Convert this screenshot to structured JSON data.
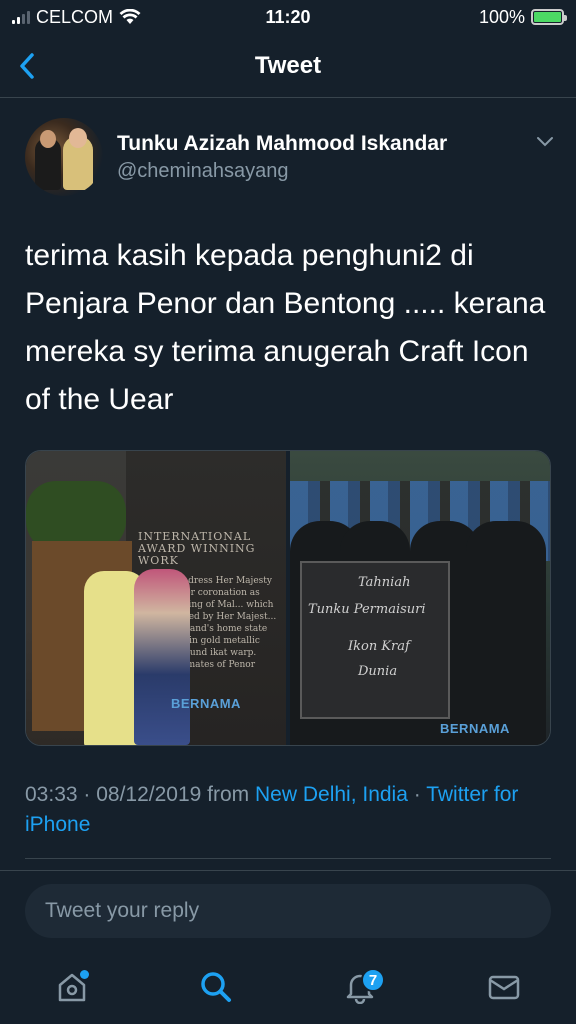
{
  "status_bar": {
    "carrier": "CELCOM",
    "time": "11:20",
    "battery": "100%"
  },
  "header": {
    "title": "Tweet"
  },
  "tweet": {
    "author_name": "Tunku Azizah Mahmood Iskandar",
    "author_handle": "@cheminahsayang",
    "text": "terima kasih kepada penghuni2 di Penjara Penor dan Bentong ..... kerana mereka sy terima anugerah Craft Icon of the Uear",
    "timestamp": "03:33 · 08/12/2019 from ",
    "location": "New Delhi, India",
    "separator": " · ",
    "source": "Twitter for iPhone"
  },
  "media": {
    "image1": {
      "plaque": "INTERNATIONAL AWARD WINNING WORK",
      "caption": "This is the dress Her Majesty wore for her coronation as The 16th King of Mal... which was designed by Her Majest... of her husband's home state of... motifs in gold metallic embe... ground ikat warp. ...by the inmates of Penor Priso...",
      "watermark": "BERNAMA"
    },
    "image2": {
      "board_lines": [
        "Tahniah",
        "Tunku Permaisuri",
        "Ikon Kraf",
        "Dunia"
      ],
      "watermark": "BERNAMA"
    }
  },
  "reply": {
    "placeholder": "Tweet your reply"
  },
  "tabbar": {
    "notifications_count": "7"
  },
  "colors": {
    "background": "#15202b",
    "accent": "#1da1f2",
    "muted": "#8899a6",
    "divider": "#38444d"
  }
}
